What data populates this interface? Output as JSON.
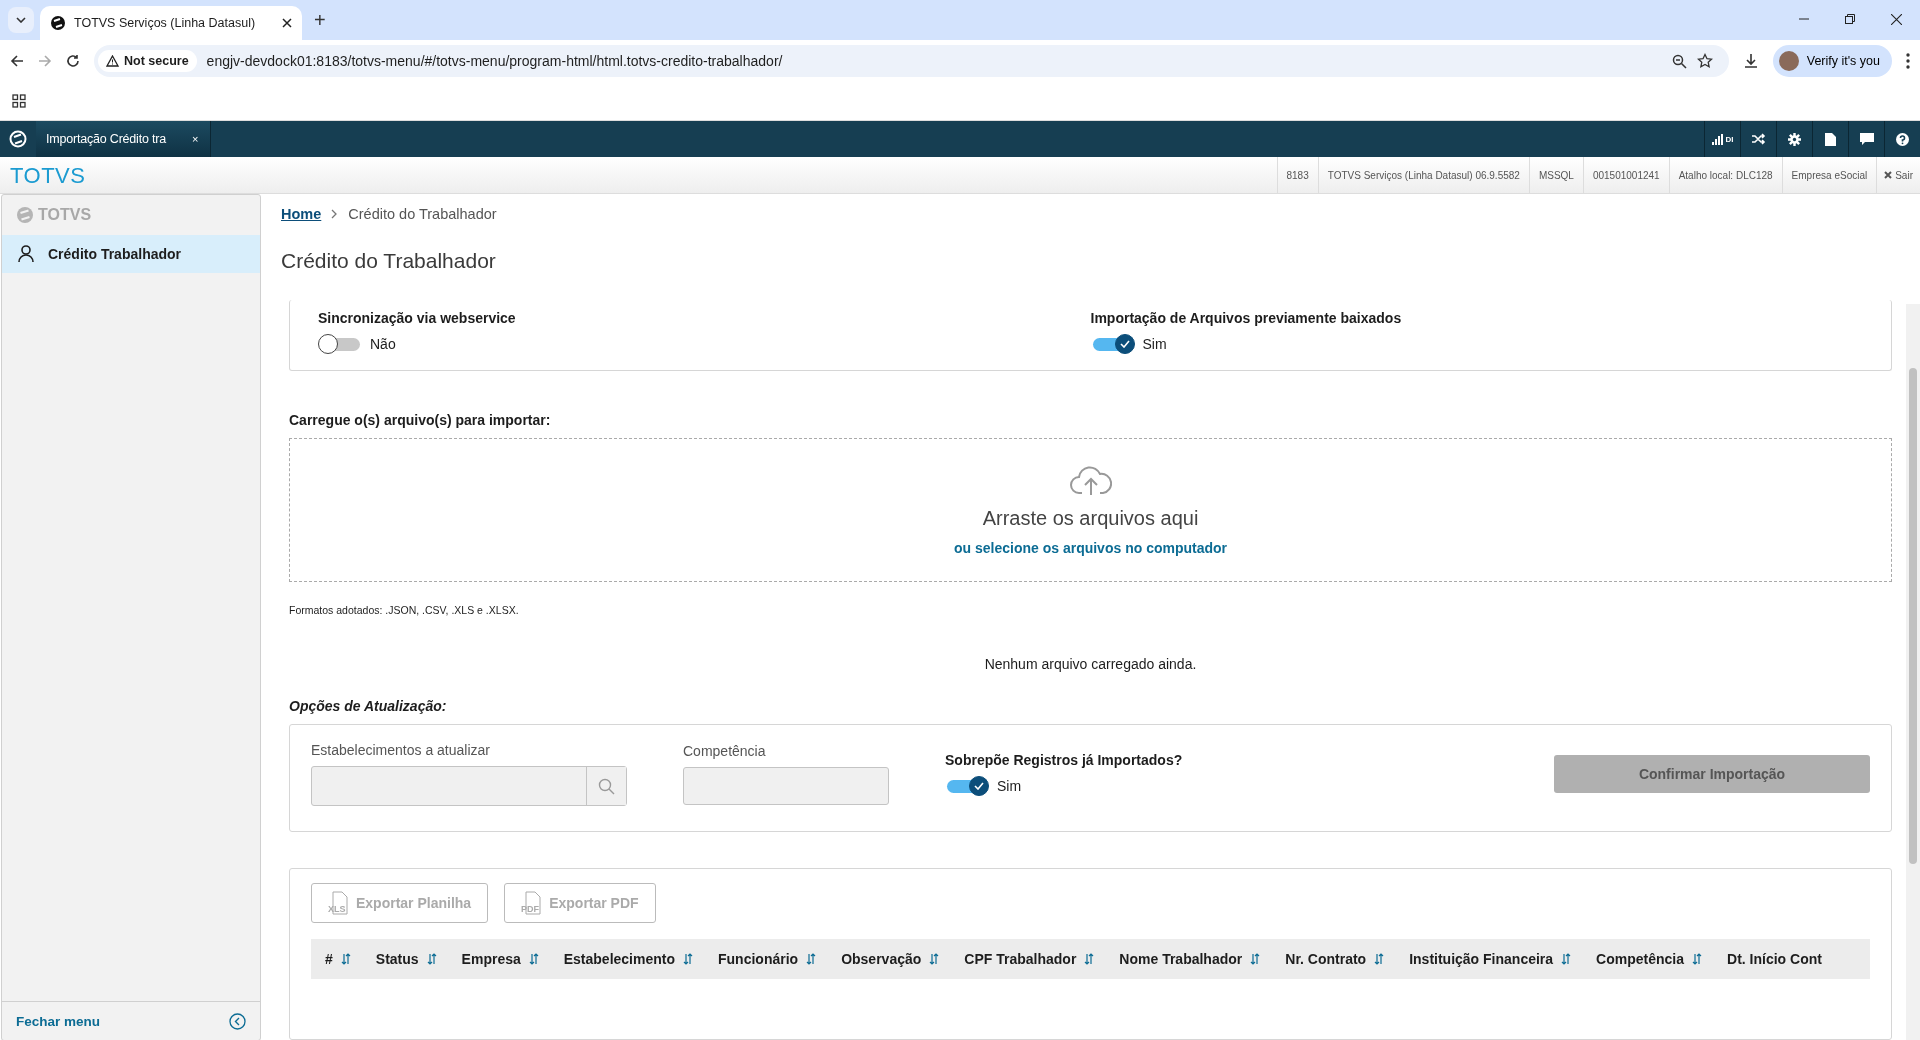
{
  "browser": {
    "tabs": [
      {
        "title": "TOTVS Serviços (Linha Datasul)",
        "selected": true
      }
    ],
    "new_tab": "+",
    "security": "Not secure",
    "url": "engjv-devdock01:8183/totvs-menu/#/totvs-menu/program-html/html.totvs-credito-trabalhador/",
    "profile_button": "Verify it's you"
  },
  "app_header": {
    "tabs": [
      {
        "label": "Importação Crédito tra",
        "close": "×",
        "selected": true
      }
    ],
    "signal_label": "DI"
  },
  "info_bar": {
    "brand": "TOTVS",
    "items": [
      "8183",
      "TOTVS Serviços (Linha Datasul) 06.9.5582",
      "MSSQL",
      "001501001241",
      "Atalho local: DLC128",
      "Empresa eSocial"
    ],
    "logout": "Sair"
  },
  "sidebar": {
    "logo": "TOTVS",
    "items": [
      {
        "label": "Crédito Trabalhador",
        "selected": true
      }
    ],
    "footer": "Fechar menu"
  },
  "breadcrumb": [
    {
      "label": "Home",
      "link": true
    },
    {
      "label": "Crédito do Trabalhador",
      "link": false
    }
  ],
  "page_title": "Crédito do Trabalhador",
  "sync_options": [
    {
      "label": "Sincronização via webservice",
      "on": false,
      "value": "Não"
    },
    {
      "label": "Importação de Arquivos previamente baixados",
      "on": true,
      "value": "Sim"
    }
  ],
  "upload": {
    "label": "Carregue o(s) arquivo(s) para importar:",
    "drop_text": "Arraste os arquivos aqui",
    "select_link": "ou selecione os arquivos no computador",
    "formats": "Formatos adotados: .JSON, .CSV, .XLS e .XLSX.",
    "empty_message": "Nenhum arquivo carregado ainda."
  },
  "update_options": {
    "title": "Opções de Atualização:",
    "establishments_label": "Estabelecimentos a atualizar",
    "period_label": "Competência",
    "overwrite": {
      "label": "Sobrepõe Registros já Importados?",
      "on": true,
      "value": "Sim"
    },
    "confirm_button": {
      "label": "Confirmar Importação",
      "disabled": true
    }
  },
  "export_buttons": [
    {
      "label": "Exportar Planilha",
      "icon": "XLS",
      "disabled": true
    },
    {
      "label": "Exportar PDF",
      "icon": "PDF",
      "disabled": true
    }
  ],
  "table": {
    "columns": [
      "#",
      "Status",
      "Empresa",
      "Estabelecimento",
      "Funcionário",
      "Observação",
      "CPF Trabalhador",
      "Nome Trabalhador",
      "Nr. Contrato",
      "Instituição Financeira",
      "Competência",
      "Dt. Início Cont"
    ]
  }
}
